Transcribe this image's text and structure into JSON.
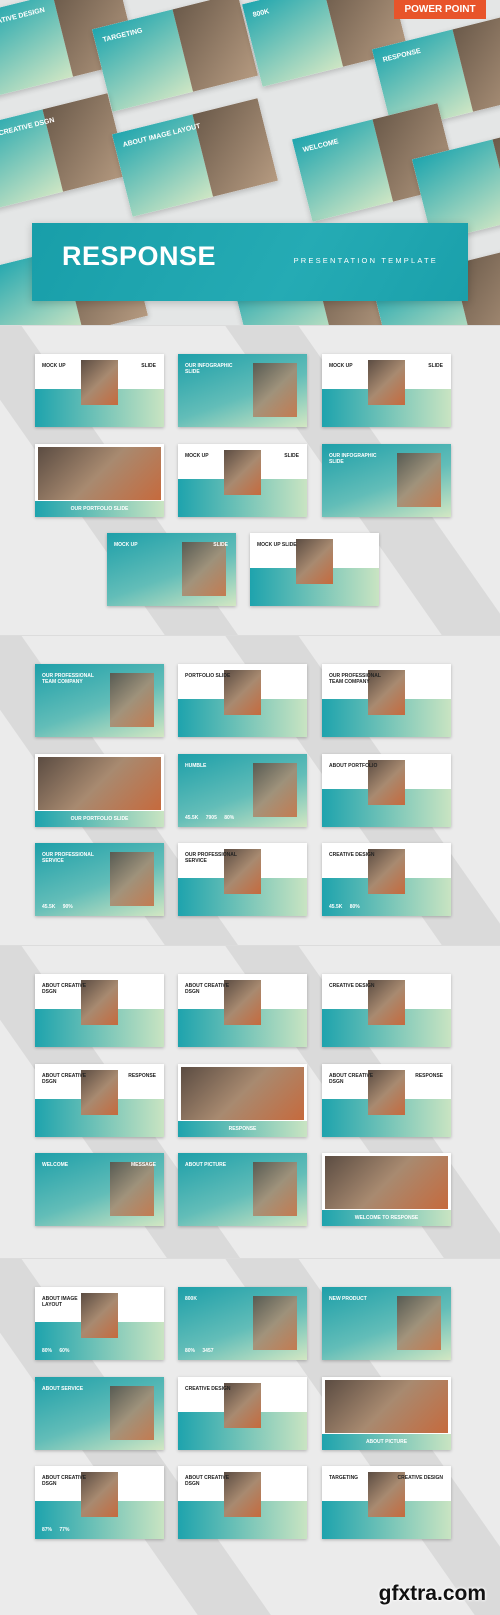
{
  "badge": "POWER POINT",
  "banner": {
    "title": "RESPONSE",
    "subtitle": "PRESENTATION TEMPLATE"
  },
  "hero_slides": [
    "CREATIVE DESIGN",
    "TARGETING",
    "800K",
    "RESPONSE",
    "ABOUT CREATIVE DSGN",
    "ABOUT IMAGE LAYOUT",
    "WELCOME"
  ],
  "colors": {
    "accent": "#1ea3ad",
    "gradient_end": "#c9e4c2",
    "badge": "#e8542a"
  },
  "sections": [
    {
      "slides": [
        {
          "title": "MOCK UP",
          "sub": "SLIDE",
          "style": "white"
        },
        {
          "title": "OUR INFOGRAPHIC SLIDE",
          "style": "teal"
        },
        {
          "title": "MOCK UP",
          "sub": "SLIDE",
          "style": "white"
        },
        {
          "title": "OUR PORTFOLIO SLIDE",
          "style": "photo"
        },
        {
          "title": "MOCK UP",
          "sub": "SLIDE",
          "style": "white"
        },
        {
          "title": "OUR INFOGRAPHIC SLIDE",
          "style": "teal"
        },
        {
          "title": "MOCK UP",
          "sub": "SLIDE",
          "style": "teal"
        },
        {
          "title": "MOCK UP SLIDE",
          "style": "white"
        }
      ]
    },
    {
      "slides": [
        {
          "title": "OUR PROFESSIONAL TEAM COMPANY",
          "style": "teal"
        },
        {
          "title": "PORTFOLIO SLIDE",
          "style": "white"
        },
        {
          "title": "OUR PROFESSIONAL TEAM COMPANY",
          "style": "white"
        },
        {
          "title": "OUR PORTFOLIO SLIDE",
          "style": "photo"
        },
        {
          "title": "HUMBLE",
          "stats": "45.5K 7905 80%",
          "style": "teal"
        },
        {
          "title": "ABOUT PORTFOLIO",
          "style": "white"
        },
        {
          "title": "OUR PROFESSIONAL SERVICE",
          "stats": "45.5K 90%",
          "style": "teal"
        },
        {
          "title": "OUR PROFESSIONAL SERVICE",
          "style": "white"
        },
        {
          "title": "CREATIVE DESIGN",
          "stats": "45.5K 80%",
          "style": "white"
        }
      ]
    },
    {
      "slides": [
        {
          "title": "ABOUT CREATIVE DSGN",
          "style": "white"
        },
        {
          "title": "ABOUT CREATIVE DSGN",
          "style": "white"
        },
        {
          "title": "CREATIVE DESIGN",
          "style": "white"
        },
        {
          "title": "ABOUT CREATIVE DSGN",
          "sub": "RESPONSE",
          "style": "white"
        },
        {
          "title": "RESPONSE",
          "style": "photo"
        },
        {
          "title": "ABOUT CREATIVE DSGN",
          "sub": "RESPONSE",
          "style": "white"
        },
        {
          "title": "WELCOME",
          "sub": "MESSAGE",
          "style": "teal"
        },
        {
          "title": "ABOUT PICTURE",
          "style": "teal"
        },
        {
          "title": "WELCOME TO RESPONSE",
          "style": "photo"
        }
      ]
    },
    {
      "slides": [
        {
          "title": "ABOUT IMAGE LAYOUT",
          "stats": "80% 60%",
          "style": "white"
        },
        {
          "title": "800K",
          "stats": "80% 3457",
          "style": "teal"
        },
        {
          "title": "NEW PRODUCT",
          "style": "teal"
        },
        {
          "title": "ABOUT SERVICE",
          "style": "teal"
        },
        {
          "title": "CREATIVE DESIGN",
          "style": "white"
        },
        {
          "title": "ABOUT PICTURE",
          "style": "photo"
        },
        {
          "title": "ABOUT CREATIVE DSGN",
          "stats": "87% 77%",
          "style": "white"
        },
        {
          "title": "ABOUT CREATIVE DSGN",
          "style": "white"
        },
        {
          "title": "TARGETING",
          "sub": "CREATIVE DESIGN",
          "style": "white"
        }
      ]
    }
  ],
  "watermark": "gfxtra.com"
}
